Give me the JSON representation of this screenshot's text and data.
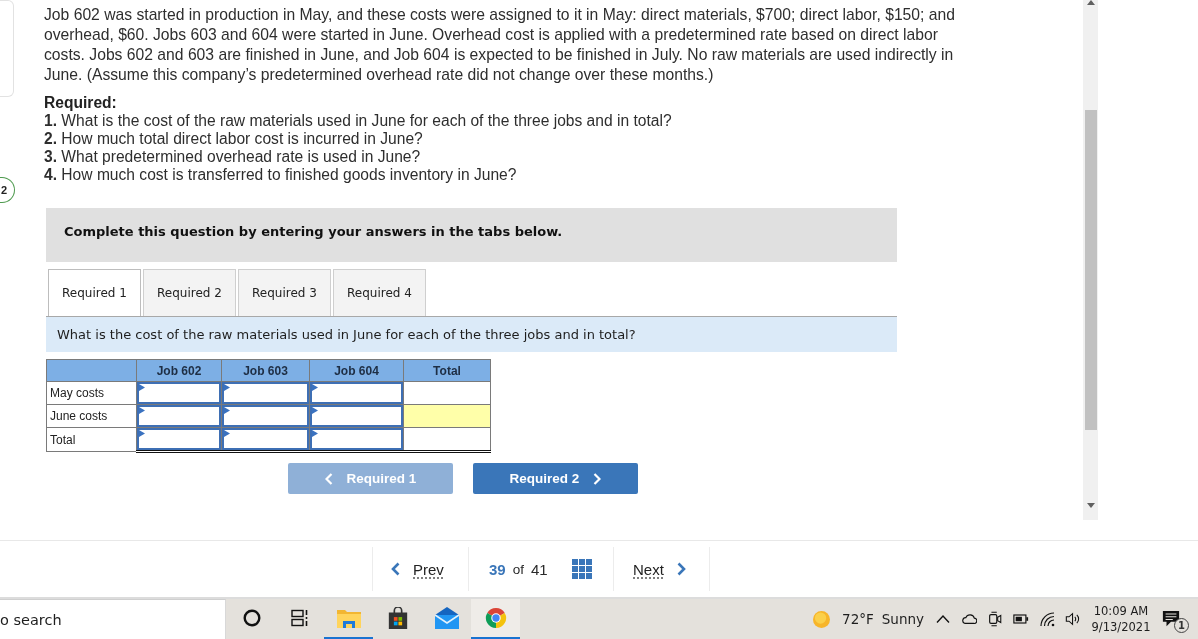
{
  "question_number": "2",
  "problem_text": "Job 602 was started in production in May, and these costs were assigned to it in May: direct materials, $700; direct labor, $150; and overhead, $60. Jobs 603 and 604 were started in June. Overhead cost is applied with a predetermined rate based on direct labor costs. Jobs 602 and 603 are finished in June, and Job 604 is expected to be finished in July. No raw materials are used indirectly in June. (Assume this company’s predetermined overhead rate did not change over these months.)",
  "required": {
    "heading": "Required:",
    "items": [
      "**1.** What is the cost of the raw materials used in June for each of the three jobs and in total?",
      "**2.** How much total direct labor cost is incurred in June?",
      "**3.** What predetermined overhead rate is used in June?",
      "**4.** How much cost is transferred to finished goods inventory in June?"
    ]
  },
  "instruction": "Complete this question by entering your answers in the tabs below.",
  "tabs": [
    {
      "label": "Required 1",
      "selected": true
    },
    {
      "label": "Required 2",
      "selected": false
    },
    {
      "label": "Required 3",
      "selected": false
    },
    {
      "label": "Required 4",
      "selected": false
    }
  ],
  "tab_prompt": "What is the cost of the raw materials used in June for each of the three jobs and in total?",
  "table": {
    "columns": [
      {
        "label": "Job 602",
        "kind": "input"
      },
      {
        "label": "Job 603",
        "kind": "input"
      },
      {
        "label": "Job 604",
        "kind": "input"
      },
      {
        "label": "Total",
        "kind": "total"
      }
    ],
    "rows": [
      {
        "label": "May costs",
        "kind": "entry",
        "total_highlighted": false
      },
      {
        "label": "June costs",
        "kind": "entry",
        "total_highlighted": true
      },
      {
        "label": "Total",
        "kind": "sum",
        "total_highlighted": false
      }
    ]
  },
  "step_buttons": [
    {
      "label": "Required 1",
      "kind": "previous",
      "disabled": true
    },
    {
      "label": "Required 2",
      "kind": "next",
      "disabled": false
    }
  ],
  "pager": {
    "prev": "Prev",
    "current": "39",
    "separator": "of",
    "total": "41",
    "next": "Next"
  },
  "taskbar": {
    "search": {
      "placeholder": "o search"
    },
    "apps": [
      {
        "kind": "ring",
        "running": false,
        "focused": false
      },
      {
        "kind": "task-view",
        "running": false,
        "focused": false
      },
      {
        "kind": "folder",
        "running": true,
        "focused": false
      },
      {
        "kind": "store",
        "running": false,
        "focused": false
      },
      {
        "kind": "mail",
        "running": false,
        "focused": false
      },
      {
        "kind": "browser",
        "running": true,
        "focused": true
      }
    ],
    "weather": {
      "temperature": "72°F",
      "condition": "Sunny"
    },
    "clock": {
      "time": "10:09 AM",
      "date": "9/13/2021"
    },
    "notifications": "1"
  }
}
